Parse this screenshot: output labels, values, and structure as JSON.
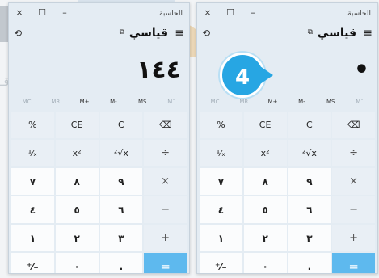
{
  "watermark": {
    "text": "مـوقـ"
  },
  "callout": {
    "number": "4"
  },
  "windows": [
    {
      "title": "الحاسبة",
      "close": "×",
      "maximize": "☐",
      "minimize": "–",
      "history_icon": "⟲",
      "keep_on_top": "⧉",
      "mode": "قياسي",
      "menu": "≡",
      "display": "١٤٤",
      "memory": [
        "MC",
        "MR",
        "M+",
        "M-",
        "MS",
        "M˅"
      ],
      "keys": [
        "%",
        "CE",
        "C",
        "⌫",
        "¹⁄ₓ",
        "x²",
        "²√x",
        "÷",
        "٧",
        "٨",
        "٩",
        "×",
        "٤",
        "٥",
        "٦",
        "−",
        "١",
        "٢",
        "٣",
        "+",
        "⁺⁄₋",
        "٠",
        ".",
        "="
      ]
    },
    {
      "title": "الحاسبة",
      "close": "×",
      "maximize": "☐",
      "minimize": "–",
      "history_icon": "⟲",
      "keep_on_top": "⧉",
      "mode": "قياسي",
      "menu": "≡",
      "display": "•",
      "memory": [
        "MC",
        "MR",
        "M+",
        "M-",
        "MS",
        "M˅"
      ],
      "keys": [
        "%",
        "CE",
        "C",
        "⌫",
        "¹⁄ₓ",
        "x²",
        "²√x",
        "÷",
        "٧",
        "٨",
        "٩",
        "×",
        "٤",
        "٥",
        "٦",
        "−",
        "١",
        "٢",
        "٣",
        "+",
        "⁺⁄₋",
        "٠",
        ".",
        "="
      ]
    }
  ]
}
